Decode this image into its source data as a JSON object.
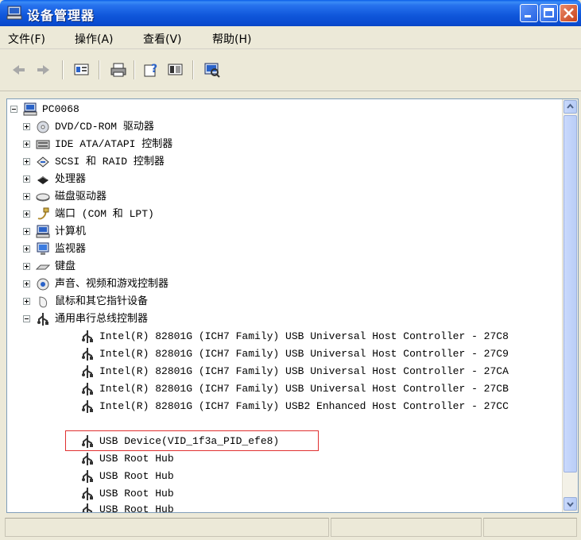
{
  "window": {
    "title": "设备管理器",
    "icon": "computer-icon"
  },
  "menu": {
    "items": [
      {
        "label": "文件(F)"
      },
      {
        "label": "操作(A)"
      },
      {
        "label": "查看(V)"
      },
      {
        "label": "帮助(H)"
      }
    ]
  },
  "toolbar": {
    "icons": [
      "back-arrow-icon",
      "forward-arrow-icon",
      "properties-icon",
      "print-icon",
      "help-icon",
      "view-icon",
      "scan-hardware-icon"
    ]
  },
  "tree": {
    "root": "PC0068",
    "categories": [
      {
        "label": "DVD/CD-ROM 驱动器",
        "icon": "cd-drive-icon"
      },
      {
        "label": "IDE ATA/ATAPI 控制器",
        "icon": "ide-controller-icon"
      },
      {
        "label": "SCSI 和 RAID 控制器",
        "icon": "scsi-controller-icon"
      },
      {
        "label": "处理器",
        "icon": "processor-icon"
      },
      {
        "label": "磁盘驱动器",
        "icon": "disk-drive-icon"
      },
      {
        "label": "端口 (COM 和 LPT)",
        "icon": "port-icon"
      },
      {
        "label": "计算机",
        "icon": "computer-icon"
      },
      {
        "label": "监视器",
        "icon": "monitor-icon"
      },
      {
        "label": "键盘",
        "icon": "keyboard-icon"
      },
      {
        "label": "声音、视频和游戏控制器",
        "icon": "sound-icon"
      },
      {
        "label": "鼠标和其它指针设备",
        "icon": "mouse-icon"
      },
      {
        "label": "通用串行总线控制器",
        "icon": "usb-icon"
      }
    ],
    "usb_children": [
      "Intel(R) 82801G (ICH7 Family) USB Universal Host Controller - 27C8",
      "Intel(R) 82801G (ICH7 Family) USB Universal Host Controller - 27C9",
      "Intel(R) 82801G (ICH7 Family) USB Universal Host Controller - 27CA",
      "Intel(R) 82801G (ICH7 Family) USB Universal Host Controller - 27CB",
      "Intel(R) 82801G (ICH7 Family) USB2 Enhanced Host Controller - 27CC",
      "USB Device(VID_1f3a_PID_efe8)",
      "USB Root Hub",
      "USB Root Hub",
      "USB Root Hub",
      "USB Root Hub"
    ]
  },
  "colors": {
    "title_bar": "#0a4bd0",
    "highlight_border": "#e03030",
    "close_button": "#c8421b"
  }
}
